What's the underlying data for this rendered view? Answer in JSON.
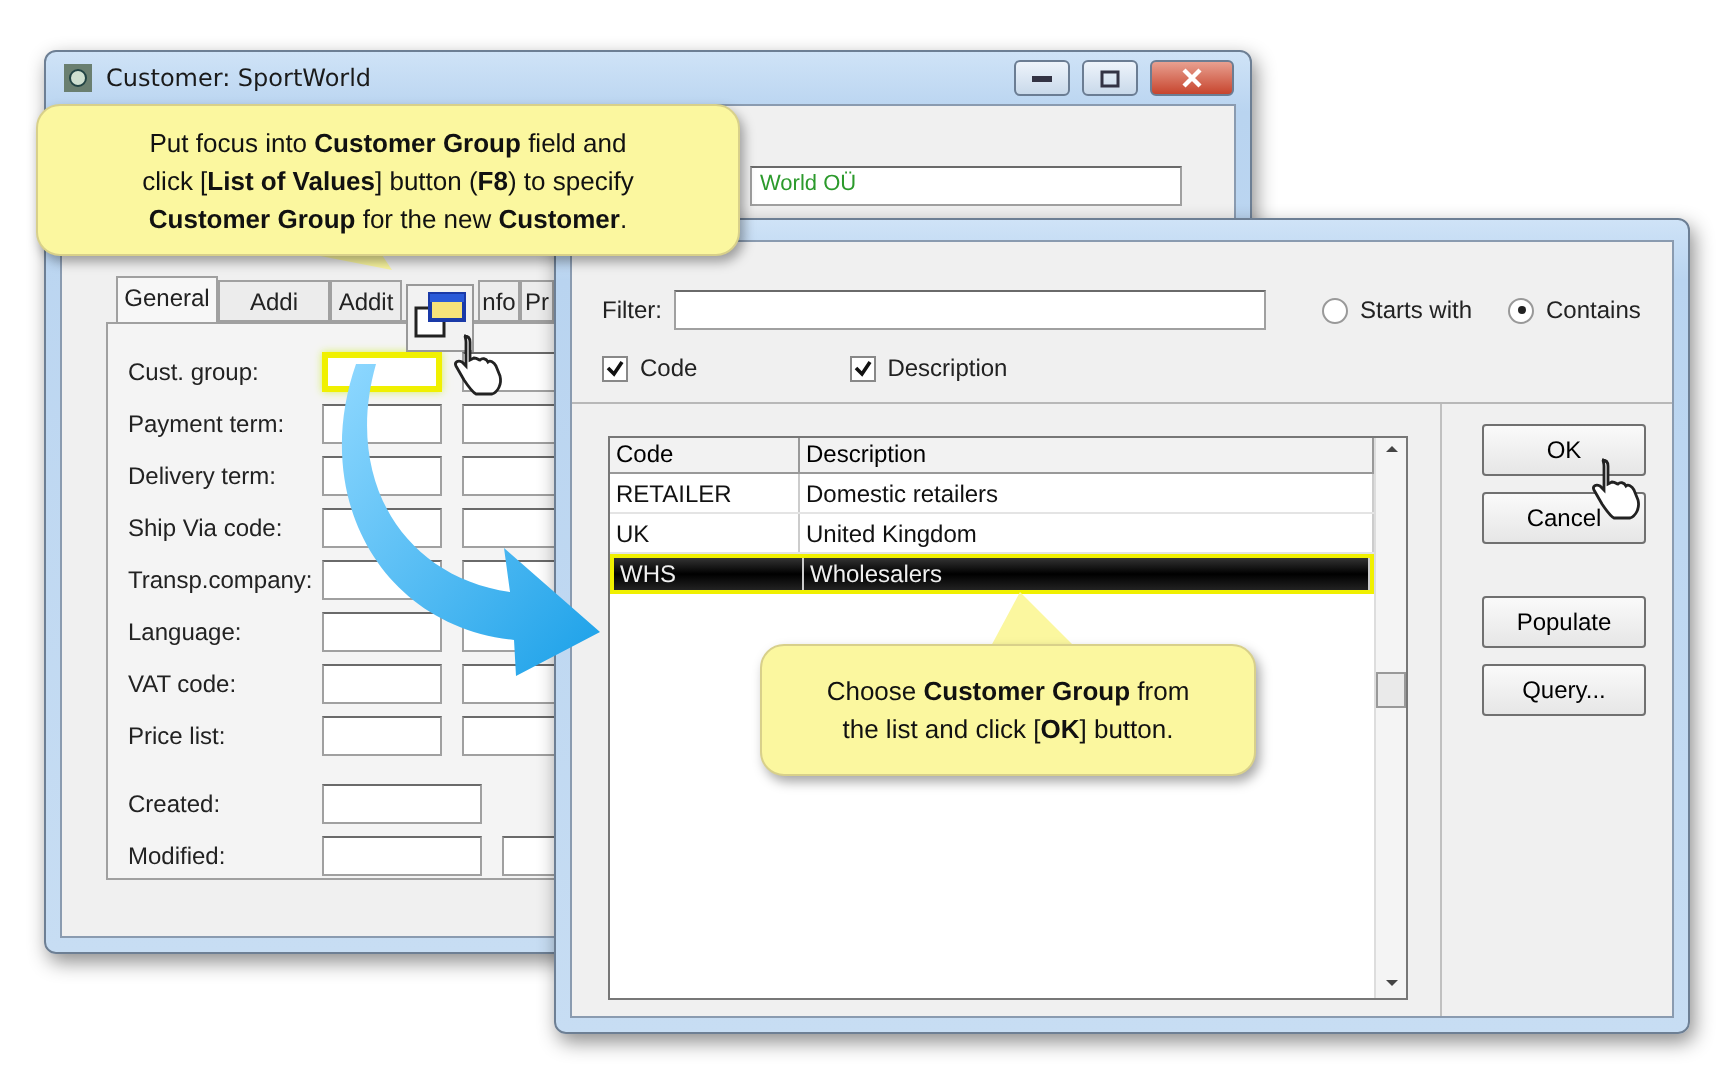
{
  "customer_window": {
    "title": "Customer: SportWorld",
    "name_value": "World OÜ",
    "tabs": [
      {
        "label": "General",
        "selected": true
      },
      {
        "label": "Addi",
        "selected": false
      },
      {
        "label": "Addit",
        "selected": false
      },
      {
        "label": "nfo",
        "selected": false
      },
      {
        "label": "Pr",
        "selected": false
      }
    ],
    "fields": [
      {
        "label": "Cust. group:",
        "kind": "pair",
        "focused": true
      },
      {
        "label": "Payment term:",
        "kind": "pair",
        "focused": false
      },
      {
        "label": "Delivery term:",
        "kind": "pair",
        "focused": false
      },
      {
        "label": "Ship Via code:",
        "kind": "pair",
        "focused": false
      },
      {
        "label": "Transp.company:",
        "kind": "pair",
        "focused": false
      },
      {
        "label": "Language:",
        "kind": "pair",
        "focused": false
      },
      {
        "label": "VAT code:",
        "kind": "pair",
        "focused": false
      },
      {
        "label": "Price list:",
        "kind": "pair",
        "focused": false
      },
      {
        "label": "Created:",
        "kind": "wide",
        "focused": false
      },
      {
        "label": "Modified:",
        "kind": "wide_pair",
        "focused": false
      }
    ]
  },
  "select_value_dialog": {
    "filter_label": "Filter:",
    "match_options": [
      {
        "label": "Starts with",
        "selected": false
      },
      {
        "label": "Contains",
        "selected": true
      }
    ],
    "search_in": [
      {
        "label": "Code",
        "checked": true
      },
      {
        "label": "Description",
        "checked": true
      }
    ],
    "columns": [
      "Code",
      "Description"
    ],
    "rows": [
      {
        "code": "RETAILER",
        "description": "Domestic retailers",
        "selected": false
      },
      {
        "code": "UK",
        "description": "United Kingdom",
        "selected": false
      },
      {
        "code": "WHS",
        "description": "Wholesalers",
        "selected": true
      }
    ],
    "buttons": [
      "OK",
      "Cancel",
      "Populate",
      "Query..."
    ]
  },
  "callouts": [
    {
      "text": "Put focus into **Customer Group** field and click [**List of Values**] button (**F8**) to specify **Customer Group** for the new **Customer**."
    },
    {
      "text": "Choose **Customer Group** from the list and click [**OK**] button."
    }
  ]
}
